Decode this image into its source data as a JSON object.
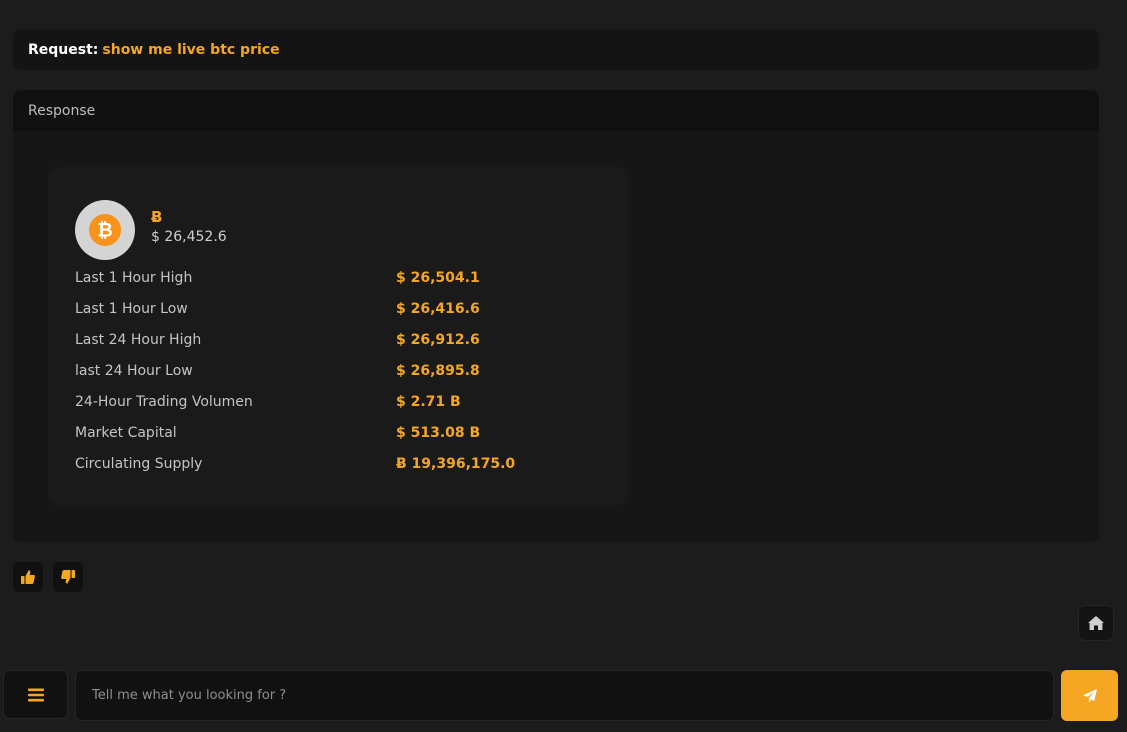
{
  "request": {
    "label": "Request:",
    "text": "show me live btc price"
  },
  "response": {
    "header": "Response",
    "coin": {
      "symbol": "Ƀ",
      "price": "$ 26,452.6",
      "icon": "bitcoin-icon",
      "stats": [
        {
          "label": "Last 1 Hour High",
          "value": "$ 26,504.1"
        },
        {
          "label": "Last 1 Hour Low",
          "value": "$ 26,416.6"
        },
        {
          "label": "Last 24 Hour High",
          "value": "$ 26,912.6"
        },
        {
          "label": "last 24 Hour Low",
          "value": "$ 26,895.8"
        },
        {
          "label": "24-Hour Trading Volumen",
          "value": "$ 2.71 B"
        },
        {
          "label": "Market Capital",
          "value": "$ 513.08 B"
        },
        {
          "label": "Circulating Supply",
          "value": "Ƀ 19,396,175.0"
        }
      ]
    }
  },
  "feedback": {
    "like_icon": "thumbs-up-icon",
    "dislike_icon": "thumbs-down-icon"
  },
  "input": {
    "placeholder": "Tell me what you looking for ?",
    "value": ""
  },
  "icons": {
    "menu": "menu-icon",
    "home": "home-icon",
    "send": "paper-plane-icon"
  },
  "colors": {
    "accent": "#f5a623",
    "background": "#1c1c1c",
    "panel": "#161616"
  }
}
